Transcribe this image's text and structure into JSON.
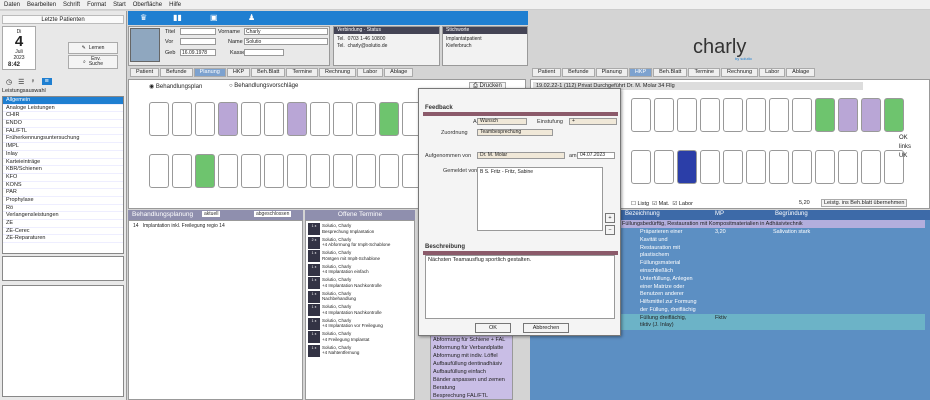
{
  "menu": [
    "Daten",
    "Bearbeiten",
    "Schrift",
    "Format",
    "Start",
    "Oberfläche",
    "Hilfe"
  ],
  "sidebar": {
    "title": "Letzte Patienten",
    "weekday": "Di",
    "day": "4",
    "month": "Juli",
    "year": "2023",
    "time": "8:42",
    "learn_btn": "Lernen",
    "env_btn_line1": "Env.",
    "env_btn_line2": "Suche",
    "list_label": "Leistungsauswahl",
    "items": [
      "Allgemein",
      "Analoge Leistungen",
      "CHIR",
      "ENDO",
      "FAL/FTL",
      "Früherkennungsuntersuchung",
      "IMPL",
      "Inlay",
      "Karteieinträge",
      "KBR/Schienen",
      "KFO",
      "KONS",
      "PAR",
      "Prophylaxe",
      "Rö",
      "Verlangensleistungen",
      "ZE",
      "ZE-Cerec",
      "ZE-Reparaturen"
    ]
  },
  "patient": {
    "title_label": "Titel",
    "first_label": "Vorname",
    "first": "Charly",
    "vor_label": "Vor",
    "name_label": "Name",
    "name": "Solutio",
    "geb_label": "Geb",
    "geb": "16.09.1978",
    "ger_label": "Ger",
    "kasse_label": "Kasse",
    "tel_label": "Tel.",
    "tel": "0703 1-46 10800",
    "email": "charly@solutio.de",
    "verbindung": "Verbindung",
    "status": "Status",
    "notes_label": "Stichworte",
    "note1": "Implantatpatient",
    "note2": "Kieferbruch",
    "age": "45"
  },
  "tabs_left": [
    "Patient",
    "Befunde",
    "Planung",
    "HKP",
    "Beh.Blatt",
    "Termine",
    "Rechnung",
    "Labor",
    "Ablage"
  ],
  "tabs_left_active": 2,
  "tabs_right": [
    "Patient",
    "Befunde",
    "Planung",
    "HKP",
    "Beh.Blatt",
    "Termine",
    "Rechnung",
    "Labor",
    "Ablage"
  ],
  "tabs_right_active": 3,
  "planning": {
    "radio1": "Behandlungsplan",
    "radio2": "Behandlungsvorschläge",
    "print": "Drucken",
    "plan_head": "Behandlungsplanung",
    "plan_filter": "aktuell",
    "plan_done": "abgeschlossen",
    "plan_row_num": "14",
    "plan_row_text": "Implantation inkl. Freilegung regio 14",
    "upper_teeth": [
      "18",
      "17",
      "16",
      "15",
      "14",
      "13",
      "12",
      "11",
      "21",
      "22",
      "23",
      "24",
      "25",
      "26",
      "27",
      "28"
    ],
    "lower_teeth": [
      "48",
      "47",
      "46",
      "45",
      "44",
      "43",
      "42",
      "41",
      "31",
      "32",
      "33",
      "34",
      "35",
      "36",
      "37",
      "38"
    ]
  },
  "open_terms": {
    "head": "Offene Termine",
    "rows": [
      {
        "badge": "1 x",
        "name": "Solutio, Charly",
        "text": "Besprechung Implantation"
      },
      {
        "badge": "2 x",
        "name": "Solutio, Charly",
        "text": "+4 Abformung für Implt-Schablone"
      },
      {
        "badge": "1 x",
        "name": "Solutio, Charly",
        "text": "Röntgen mit Implt-Schablone"
      },
      {
        "badge": "1 x",
        "name": "Solutio, Charly",
        "text": "+4 Implantation einfach"
      },
      {
        "badge": "1 x",
        "name": "Solutio, Charly",
        "text": "+4 Implantation Nachkontrolle"
      },
      {
        "badge": "1 x",
        "name": "Solutio, Charly",
        "text": "Nachbehandlung"
      },
      {
        "badge": "1 x",
        "name": "Solutio, Charly",
        "text": "+4 Implantation Nachkontrolle"
      },
      {
        "badge": "1 x",
        "name": "Solutio, Charly",
        "text": "+4 Implantation vor Freilegung"
      },
      {
        "badge": "1 x",
        "name": "Solutio, Charly",
        "text": "+4 Freilegung Implantat"
      },
      {
        "badge": "1 x",
        "name": "Solutio, Charly",
        "text": "+4 Nahtentfernung"
      }
    ]
  },
  "purple_list": [
    "Abformung für Schiene + FAL",
    "Abformung für Verbandplatte",
    "Abformung mit indiv. Löffel",
    "Aufbaufüllung dentinadhäsiv",
    "Aufbaufüllung einfach",
    "Bänder anpassen und zemen",
    "Beratung",
    "Besprechung FAL/FTL"
  ],
  "dialog": {
    "feedback": "Feedback",
    "art_label": "Art",
    "art": "Wunsch",
    "einstufung_label": "Einstufung",
    "einstufung": "+",
    "zuordnung_label": "Zuordnung",
    "zuordnung": "Teambesprechung",
    "aufgenommen_label": "Aufgenommen von",
    "aufgenommen": "Dr. M. Molar",
    "am_label": "am",
    "am": "04.07.2023",
    "gemeldet_label": "Gemeldet von",
    "gemeldet": "B   S. Fritz - Fritz, Sabine",
    "beschreibung": "Beschreibung",
    "text": "Nächsten Teamausflug sportlich gestalten.",
    "ok": "OK",
    "cancel": "Abbrechen"
  },
  "right": {
    "logo": "charly",
    "logo_sub": "by solutio",
    "info": "19.02.22-1 (112)   Privat   Durchgeführt Dr. M. Molar 34 Fllg",
    "ok": "OK",
    "links": "links",
    "uk": "UK",
    "head_cols": [
      "Nummer",
      "Bezeichnung",
      "MP",
      "",
      "Begründung"
    ],
    "row1": "Füllungsbedürftig, Restauration mit Kompositmaterialien in Adhäsivtechnik",
    "detail": [
      "Präparieren einer",
      "Kavität und",
      "Restauration mit",
      "plastischem",
      "Füllungsmaterial",
      "einschließlich",
      "Unterfüllung, Anlegen",
      "einer Matrize oder",
      "Benutzen anderer",
      "Hilfsmittel zur Formung",
      "der Füllung, dreiflächig"
    ],
    "factor": "3,20",
    "reason": "Salivation stark",
    "row2a": "Füllung dreiflächig,",
    "row2b": "tiktiv (J. Inlay)",
    "row2_mp": "Fktiv",
    "bottom_value": "5,20",
    "bottom_btn": "Leistg. ins Beh.blatt übernehmen",
    "bottom_left": "Listg",
    "bottom_mid1": "Mat.",
    "bottom_mid2": "Labor"
  },
  "colors": {
    "accent": "#1f7fd1",
    "dialog_line": "#8b5a6a",
    "purple": "#c9bee6",
    "teal": "#6cb3c7"
  }
}
